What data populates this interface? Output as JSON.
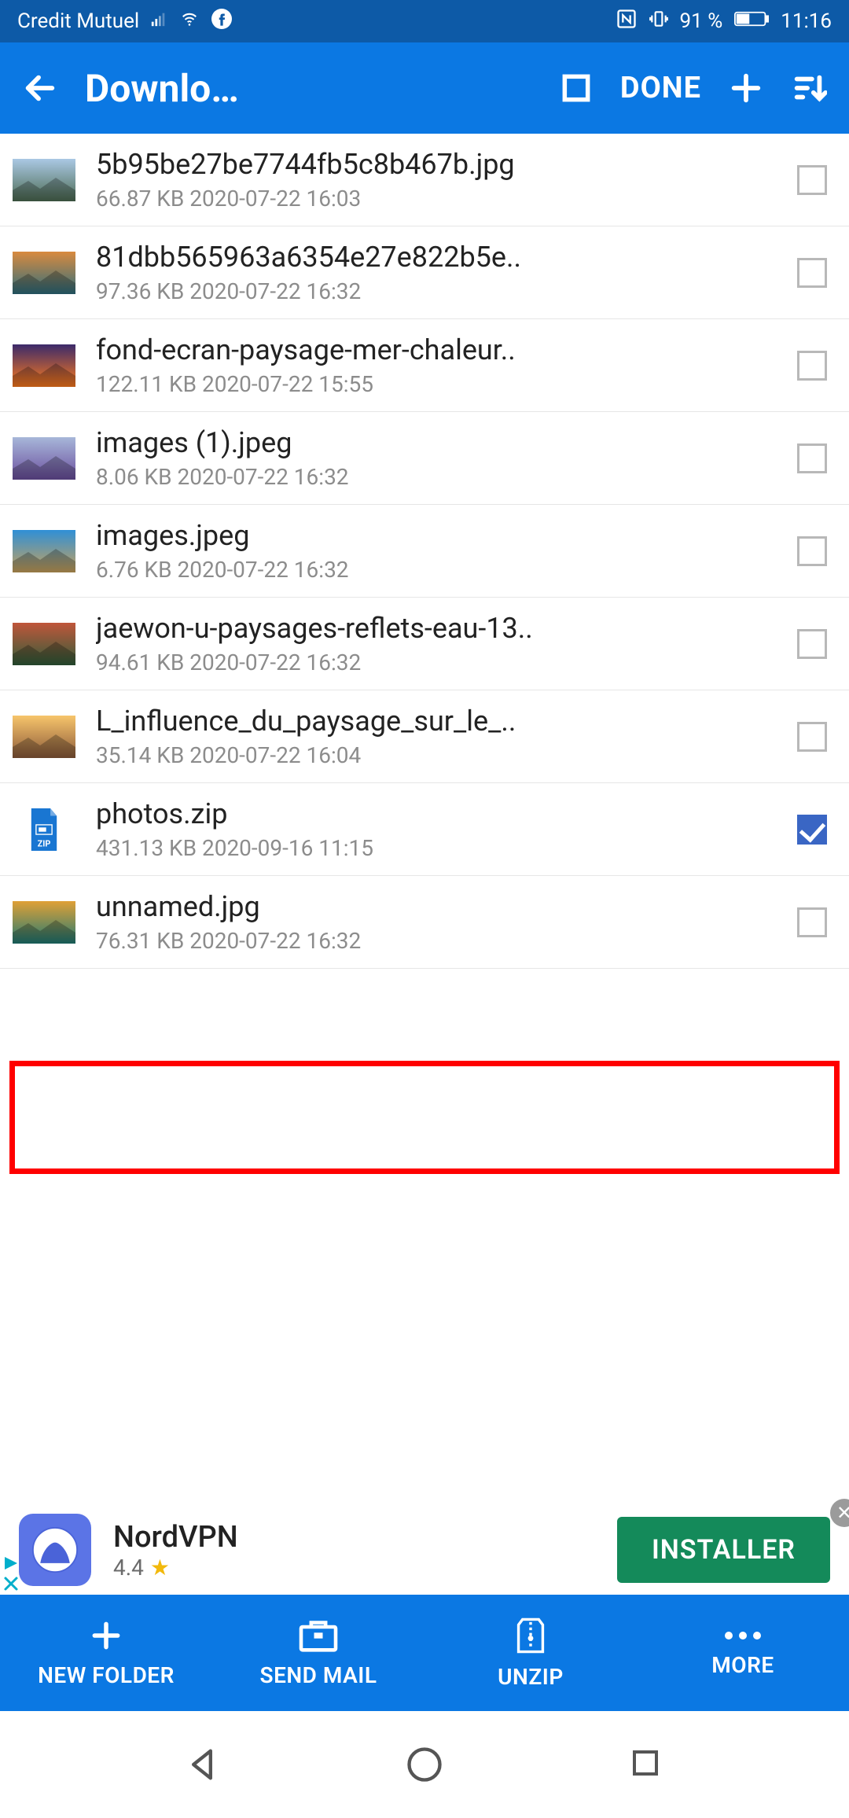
{
  "status": {
    "carrier": "Credit Mutuel",
    "battery": "91 %",
    "time": "11:16"
  },
  "appbar": {
    "title": "Downlo…",
    "done": "DONE"
  },
  "files": [
    {
      "name": "5b95be27be7744fb5c8b467b.jpg",
      "size": "66.87 KB",
      "date": "2020-07-22 16:03",
      "checked": false,
      "thumb": "sky-lake"
    },
    {
      "name": "81dbb565963a6354e27e822b5e..",
      "size": "97.36 KB",
      "date": "2020-07-22 16:32",
      "checked": false,
      "thumb": "autumn-water"
    },
    {
      "name": "fond-ecran-paysage-mer-chaleur..",
      "size": "122.11 KB",
      "date": "2020-07-22 15:55",
      "checked": false,
      "thumb": "sunset-sea"
    },
    {
      "name": "images (1).jpeg",
      "size": "8.06 KB",
      "date": "2020-07-22 16:32",
      "checked": false,
      "thumb": "lavender"
    },
    {
      "name": "images.jpeg",
      "size": "6.76 KB",
      "date": "2020-07-22 16:32",
      "checked": false,
      "thumb": "tree-coast"
    },
    {
      "name": "jaewon-u-paysages-reflets-eau-13..",
      "size": "94.61 KB",
      "date": "2020-07-22 16:32",
      "checked": false,
      "thumb": "reflect"
    },
    {
      "name": "L_influence_du_paysage_sur_le_..",
      "size": "35.14 KB",
      "date": "2020-07-22 16:04",
      "checked": false,
      "thumb": "pier-sunset"
    },
    {
      "name": "photos.zip",
      "size": "431.13 KB",
      "date": "2020-09-16 11:15",
      "checked": true,
      "thumb": "zip"
    },
    {
      "name": "unnamed.jpg",
      "size": "76.31 KB",
      "date": "2020-07-22 16:32",
      "checked": false,
      "thumb": "mountain-lake"
    }
  ],
  "ad": {
    "title": "NordVPN",
    "rating": "4.4",
    "button": "INSTALLER"
  },
  "actions": {
    "new_folder": "NEW FOLDER",
    "send_mail": "SEND MAIL",
    "unzip": "UNZIP",
    "more": "MORE"
  }
}
